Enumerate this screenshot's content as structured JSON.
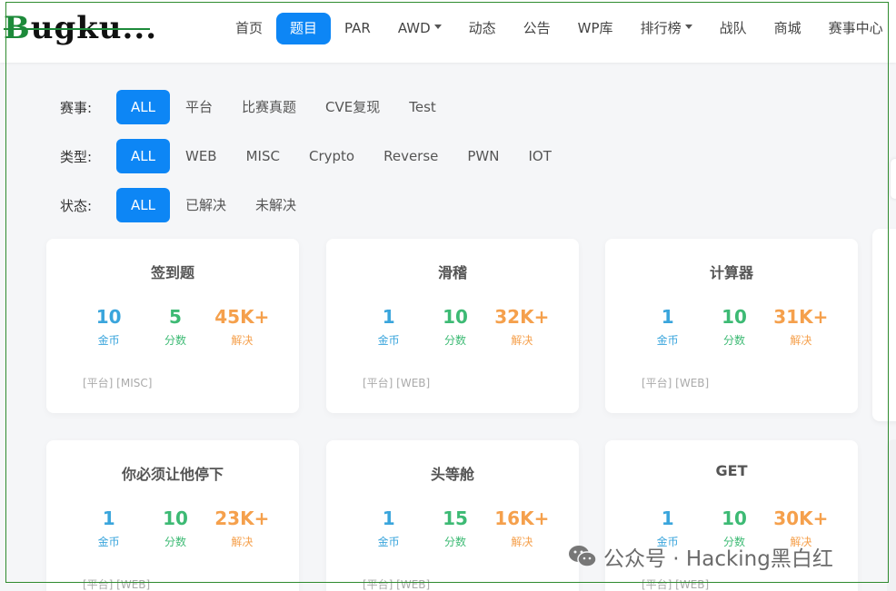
{
  "app": {
    "logo_text": "Bugku..."
  },
  "nav": {
    "items": [
      {
        "label": "首页",
        "active": false,
        "dropdown": false
      },
      {
        "label": "题目",
        "active": true,
        "dropdown": false
      },
      {
        "label": "PAR",
        "active": false,
        "dropdown": false
      },
      {
        "label": "AWD",
        "active": false,
        "dropdown": true
      },
      {
        "label": "动态",
        "active": false,
        "dropdown": false
      },
      {
        "label": "公告",
        "active": false,
        "dropdown": false
      },
      {
        "label": "WP库",
        "active": false,
        "dropdown": false
      },
      {
        "label": "排行榜",
        "active": false,
        "dropdown": true
      },
      {
        "label": "战队",
        "active": false,
        "dropdown": false
      },
      {
        "label": "商城",
        "active": false,
        "dropdown": false
      },
      {
        "label": "赛事中心",
        "active": false,
        "dropdown": false
      }
    ]
  },
  "filters": {
    "event": {
      "label": "赛事:",
      "options": [
        "ALL",
        "平台",
        "比赛真题",
        "CVE复现",
        "Test"
      ],
      "selected": "ALL"
    },
    "type": {
      "label": "类型:",
      "options": [
        "ALL",
        "WEB",
        "MISC",
        "Crypto",
        "Reverse",
        "PWN",
        "IOT"
      ],
      "selected": "ALL"
    },
    "status": {
      "label": "状态:",
      "options": [
        "ALL",
        "已解决",
        "未解决"
      ],
      "selected": "ALL"
    }
  },
  "labels": {
    "coins": "金币",
    "points": "分数",
    "solved": "解决"
  },
  "challenges": [
    {
      "title": "签到题",
      "coins": "10",
      "points": "5",
      "solved": "45K+",
      "tags": "[平台] [MISC]"
    },
    {
      "title": "滑稽",
      "coins": "1",
      "points": "10",
      "solved": "32K+",
      "tags": "[平台] [WEB]"
    },
    {
      "title": "计算器",
      "coins": "1",
      "points": "10",
      "solved": "31K+",
      "tags": "[平台] [WEB]"
    },
    {
      "title": "你必须让他停下",
      "coins": "1",
      "points": "10",
      "solved": "23K+",
      "tags": "[平台] [WEB]"
    },
    {
      "title": "头等舱",
      "coins": "1",
      "points": "15",
      "solved": "16K+",
      "tags": "[平台] [WEB]"
    },
    {
      "title": "GET",
      "coins": "1",
      "points": "10",
      "solved": "30K+",
      "tags": "[平台] [WEB]"
    }
  ],
  "watermark": {
    "text": "公众号 · Hacking黑白红",
    "icon": "wechat-icon"
  },
  "colors": {
    "accent": "#0d86f5",
    "coins": "#3aa5dc",
    "points": "#3dba74",
    "solved": "#f5a04c"
  }
}
